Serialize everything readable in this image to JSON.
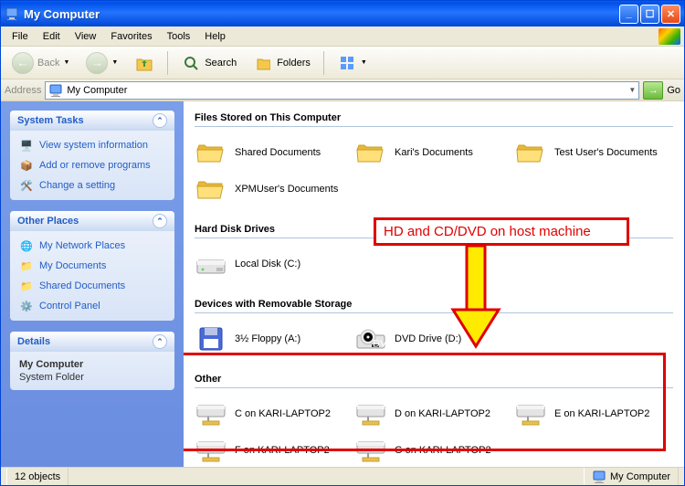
{
  "window": {
    "title": "My Computer"
  },
  "menu": {
    "file": "File",
    "edit": "Edit",
    "view": "View",
    "favorites": "Favorites",
    "tools": "Tools",
    "help": "Help"
  },
  "toolbar": {
    "back": "Back",
    "search": "Search",
    "folders": "Folders"
  },
  "addressbar": {
    "label": "Address",
    "value": "My Computer",
    "go": "Go"
  },
  "sidebar": {
    "system_tasks": {
      "title": "System Tasks",
      "items": [
        "View system information",
        "Add or remove programs",
        "Change a setting"
      ]
    },
    "other_places": {
      "title": "Other Places",
      "items": [
        "My Network Places",
        "My Documents",
        "Shared Documents",
        "Control Panel"
      ]
    },
    "details": {
      "title": "Details",
      "name": "My Computer",
      "type": "System Folder"
    }
  },
  "groups": {
    "files": {
      "title": "Files Stored on This Computer",
      "items": [
        "Shared Documents",
        "Kari's Documents",
        "Test User's Documents",
        "XPMUser's Documents"
      ]
    },
    "hdd": {
      "title": "Hard Disk Drives",
      "items": [
        "Local Disk (C:)"
      ]
    },
    "removable": {
      "title": "Devices with Removable Storage",
      "items": [
        "3½ Floppy (A:)",
        "DVD Drive (D:)"
      ]
    },
    "other": {
      "title": "Other",
      "items": [
        "C on KARI-LAPTOP2",
        "D on KARI-LAPTOP2",
        "E on KARI-LAPTOP2",
        "F on KARI-LAPTOP2",
        "G on KARI-LAPTOP2"
      ]
    }
  },
  "annotation": {
    "text": "HD and CD/DVD on host machine"
  },
  "statusbar": {
    "count": "12 objects",
    "location": "My Computer"
  }
}
